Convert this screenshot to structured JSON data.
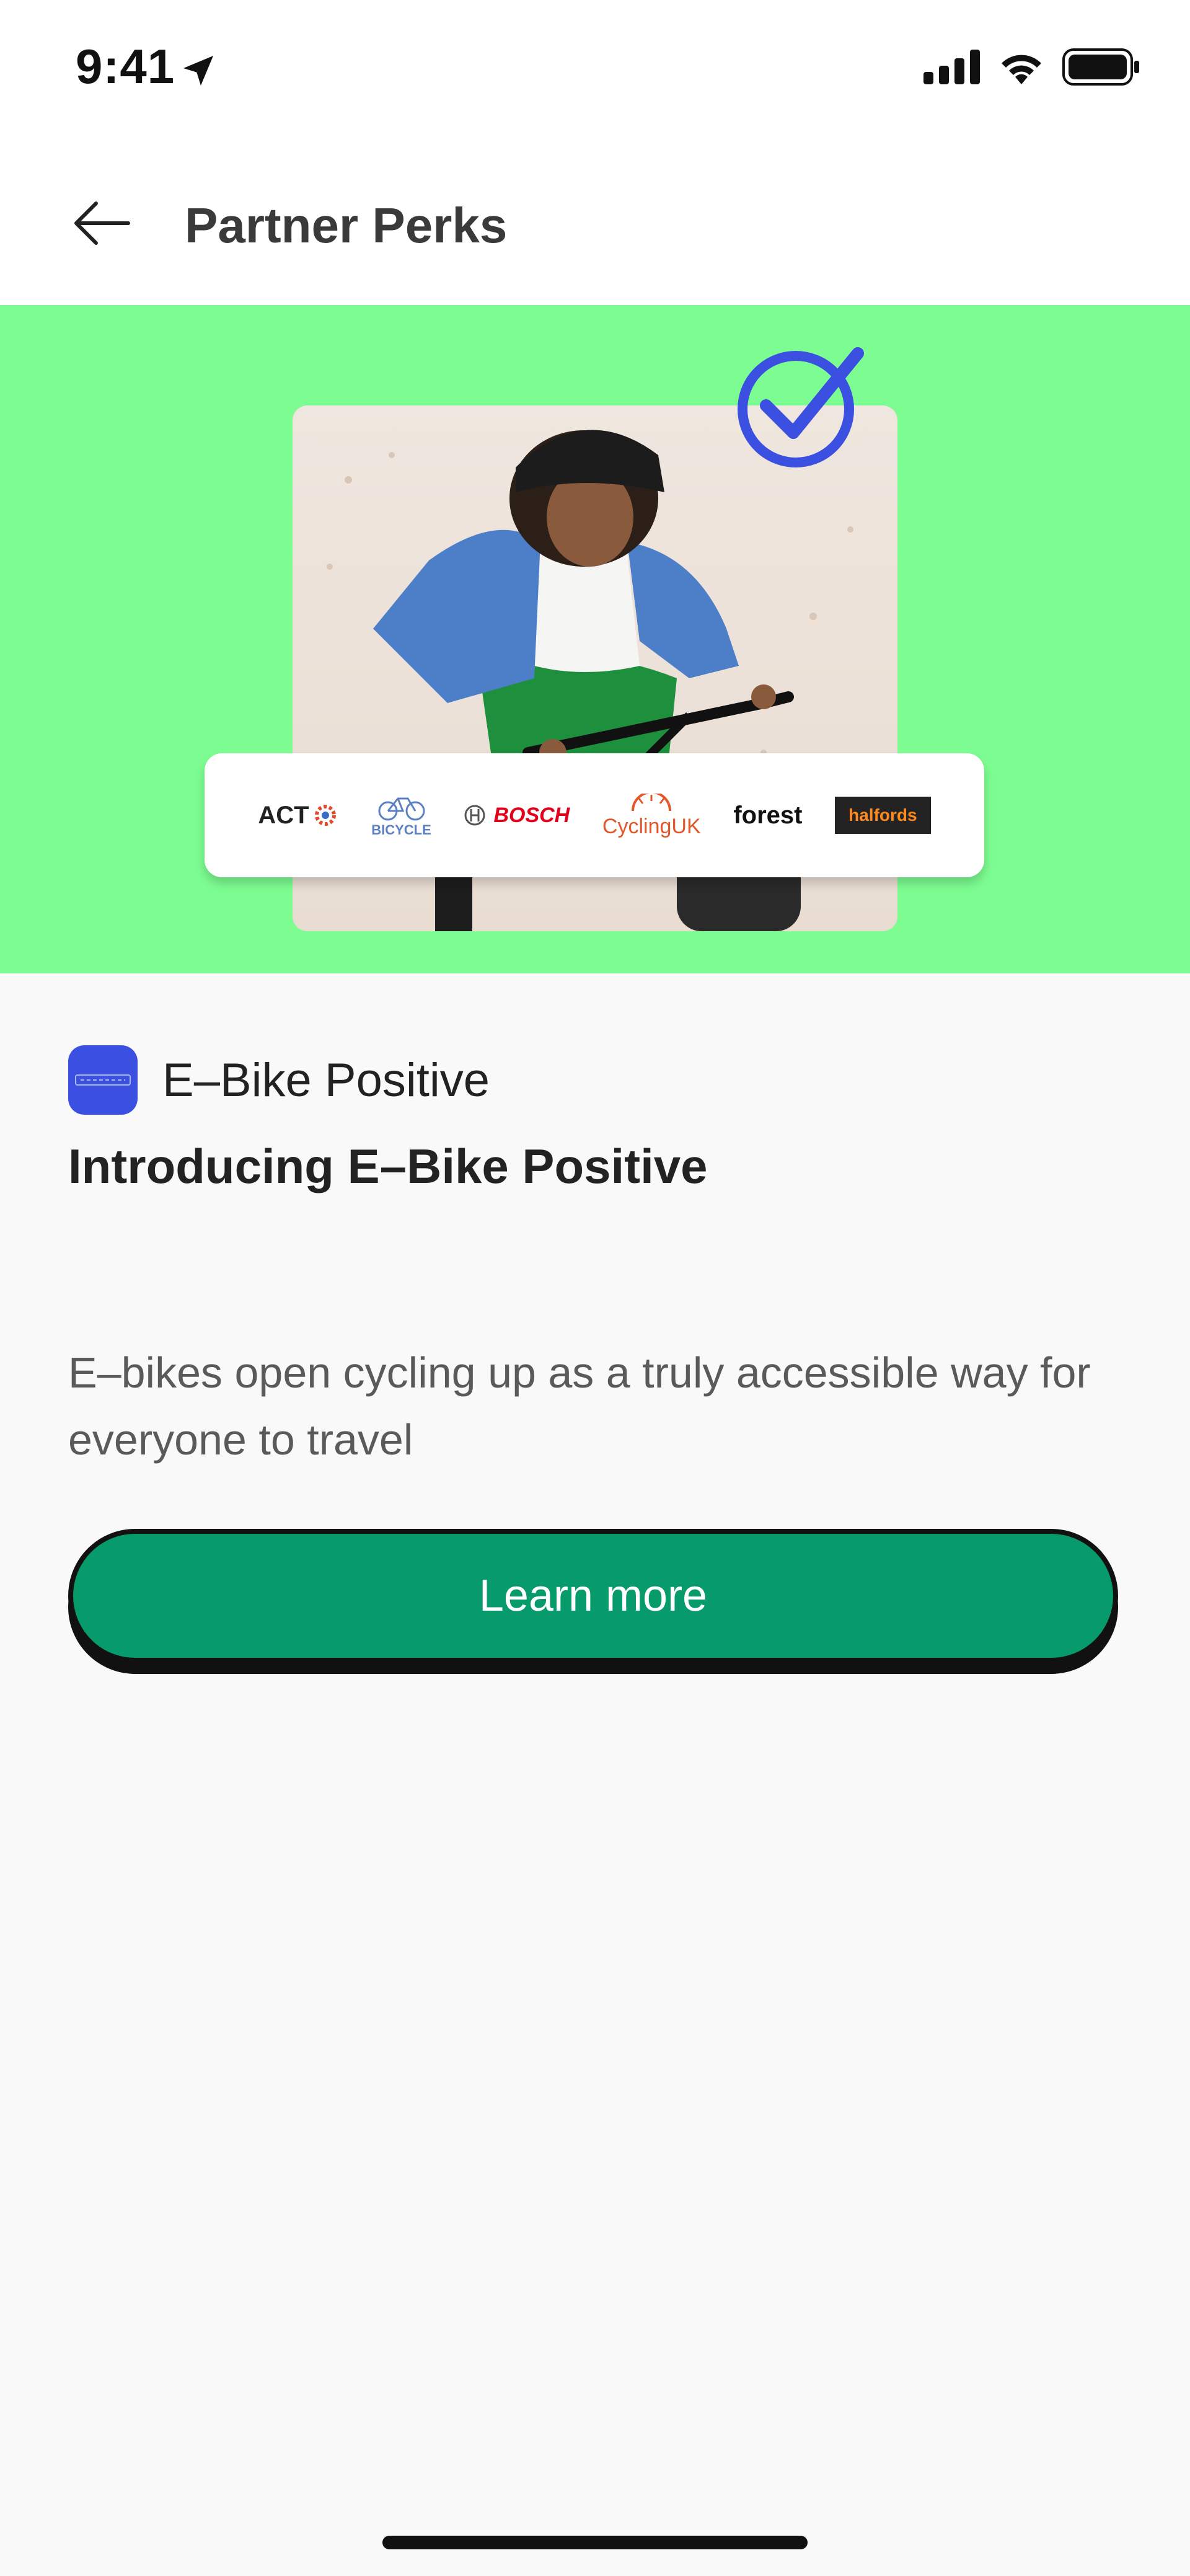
{
  "status_bar": {
    "time": "9:41"
  },
  "header": {
    "title": "Partner Perks"
  },
  "hero": {
    "partner_logos": [
      {
        "name": "ACT",
        "text": "ACT"
      },
      {
        "name": "Bicycle Association",
        "text": "BICYCLE"
      },
      {
        "name": "Bosch",
        "text": "BOSCH"
      },
      {
        "name": "Cycling UK",
        "text": "CyclingUK"
      },
      {
        "name": "Forest",
        "text": "forest"
      },
      {
        "name": "Halfords",
        "text": "halfords"
      }
    ]
  },
  "perk": {
    "brand_name": "E–Bike Positive",
    "headline": "Introducing E–Bike Positive",
    "description": "E–bikes open cycling up as a truly accessible way for everyone to travel",
    "cta_label": "Learn more"
  },
  "colors": {
    "hero_bg": "#7dfd91",
    "cta_bg": "#079a6b",
    "brand_icon_bg": "#3b4fe0",
    "check_blue": "#3b4fe0"
  }
}
